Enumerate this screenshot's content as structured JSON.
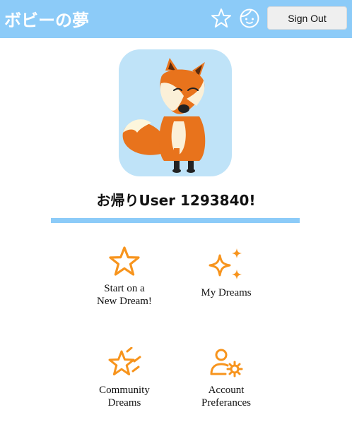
{
  "header": {
    "brand": "ボビーの夢",
    "sign_out_label": "Sign Out",
    "icons": [
      "star-icon",
      "face-icon"
    ],
    "background": "#8ccbf8"
  },
  "profile": {
    "avatar": "fox-illustration",
    "welcome_text": "お帰りUser 1293840!"
  },
  "menu": {
    "accent_color": "#f7941d",
    "items": [
      {
        "line1": "Start on a",
        "line2": "New Dream!",
        "icon": "star-icon"
      },
      {
        "line1": "My Dreams",
        "line2": "",
        "icon": "sparkles-icon"
      },
      {
        "line1": "Community",
        "line2": "Dreams",
        "icon": "shooting-star-icon"
      },
      {
        "line1": "Account",
        "line2": "Preferances",
        "icon": "user-gear-icon"
      }
    ]
  }
}
